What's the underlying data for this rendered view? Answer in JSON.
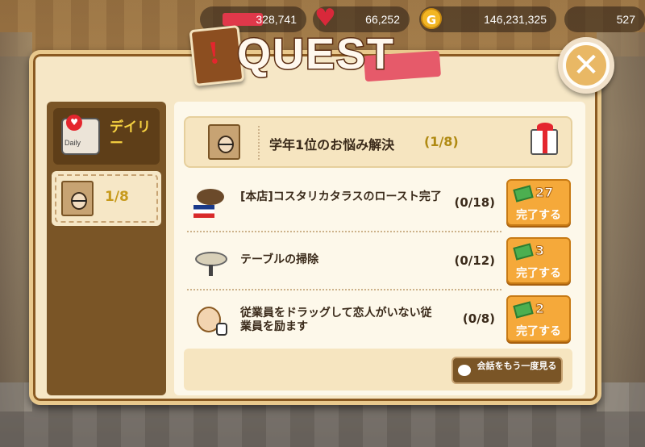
{
  "status_bar": {
    "xp_value": "328,741",
    "hearts_value": "66,252",
    "gold_icon": "G",
    "gold_value": "146,231,325",
    "right_value": "527"
  },
  "dialog": {
    "title": "QUEST",
    "close_symbol": "✕"
  },
  "sidebar": {
    "tab_daily": {
      "label": "デイリー",
      "icon_text": "Daily"
    },
    "tab_quest": {
      "count": "1/8"
    }
  },
  "header": {
    "title": "学年1位のお悩み解決",
    "progress": "(1/8)"
  },
  "tasks": [
    {
      "name": "[本店]コスタリカタラスのロースト完了",
      "progress": "(0/18)",
      "reward": "27",
      "button": "完了する"
    },
    {
      "name": "テーブルの掃除",
      "progress": "(0/12)",
      "reward": "3",
      "button": "完了する"
    },
    {
      "name": "従業員をドラッグして恋人がいない従業員を励ます",
      "progress": "(0/8)",
      "reward": "2",
      "button": "完了する"
    }
  ],
  "footer": {
    "replay_label": "会話をもう一度見る"
  },
  "colors": {
    "panel_bg": "#fdf8ea",
    "claim_button": "#f5a93a",
    "sidebar": "#7a5526",
    "highlight": "#f5d040"
  }
}
